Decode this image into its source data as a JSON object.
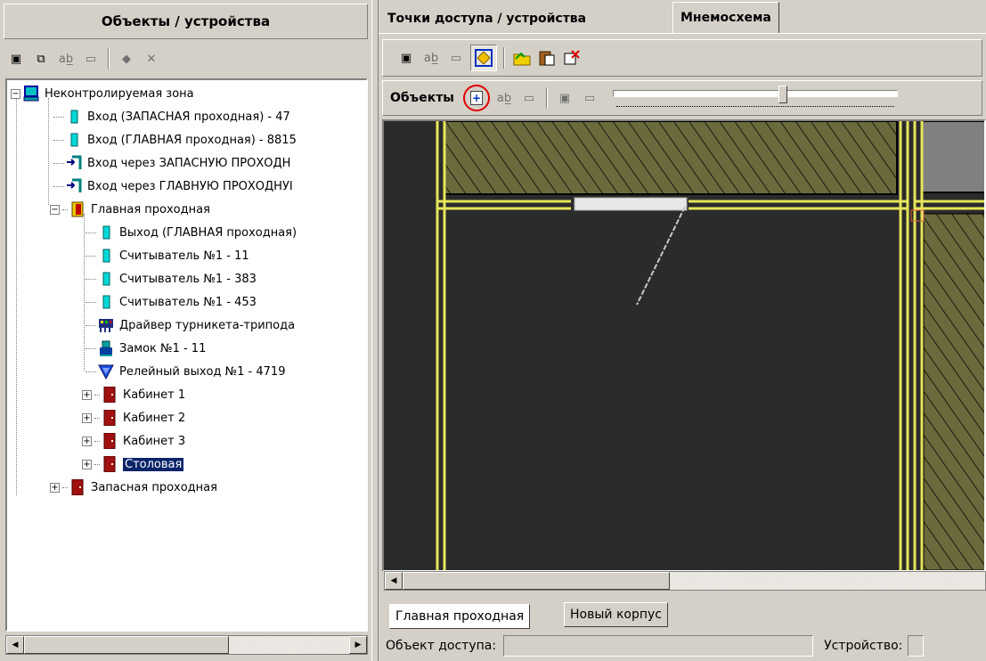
{
  "left_panel": {
    "title": "Объекты / устройства",
    "toolbar_icons": [
      "add-object-icon",
      "add-child-icon",
      "rename-icon",
      "delete-icon",
      "paint-icon",
      "remove-icon"
    ],
    "tree": [
      {
        "label": "Неконтролируемая зона",
        "icon": "computer-icon",
        "level": 0,
        "expander": "−"
      },
      {
        "label": "Вход (ЗАПАСНАЯ проходная) - 47",
        "icon": "reader-icon",
        "level": 1
      },
      {
        "label": "Вход (ГЛАВНАЯ проходная) - 8815",
        "icon": "reader-icon",
        "level": 1
      },
      {
        "label": "Вход через ЗАПАСНУЮ ПРОХОДН",
        "icon": "door-arrow-icon",
        "level": 1
      },
      {
        "label": "Вход через ГЛАВНУЮ ПРОХОДНУІ",
        "icon": "door-arrow-icon",
        "level": 1
      },
      {
        "label": "Главная проходная",
        "icon": "turnstile-door-icon",
        "level": 1,
        "expander": "−"
      },
      {
        "label": "Выход (ГЛАВНАЯ проходная)",
        "icon": "reader-icon",
        "level": 2
      },
      {
        "label": "Считыватель №1 - 11",
        "icon": "reader-icon",
        "level": 2
      },
      {
        "label": "Считыватель №1 - 383",
        "icon": "reader-icon",
        "level": 2
      },
      {
        "label": "Считыватель №1 - 453",
        "icon": "reader-icon",
        "level": 2
      },
      {
        "label": "Драйвер турникета-трипода",
        "icon": "driver-icon",
        "level": 2
      },
      {
        "label": "Замок №1 - 11",
        "icon": "lock-icon",
        "level": 2
      },
      {
        "label": "Релейный выход №1 - 4719",
        "icon": "relay-icon",
        "level": 2
      },
      {
        "label": "Кабинет 1",
        "icon": "door-icon",
        "level": 1,
        "expander": "+"
      },
      {
        "label": "Кабинет 2",
        "icon": "door-icon",
        "level": 1,
        "expander": "+"
      },
      {
        "label": "Кабинет 3",
        "icon": "door-icon",
        "level": 1,
        "expander": "+"
      },
      {
        "label": "Столовая",
        "icon": "door-icon",
        "level": 1,
        "expander": "+",
        "selected": true
      },
      {
        "label": "Запасная проходная",
        "icon": "door-icon",
        "level": 0,
        "expander": "+"
      }
    ]
  },
  "right_panel": {
    "tabs": [
      {
        "label": "Точки доступа / устройства",
        "active": false
      },
      {
        "label": "Мнемосхема",
        "active": true
      }
    ],
    "toolbar2_label": "Объекты",
    "zoom_slider_level": 0.6,
    "bottom_tabs": [
      {
        "label": "Главная проходная",
        "active": true
      },
      {
        "label": "Новый корпус",
        "active": false
      }
    ],
    "status": {
      "access_object_label": "Объект доступа:",
      "device_label": "Устройство:"
    }
  },
  "colors": {
    "window_bg": "#d4d0c8",
    "selection": "#0a246a",
    "canvas_bg": "#2b2b2b",
    "wall": "#e6e65a",
    "hatch": "#6b6a3d",
    "highlight_circle": "#e00000"
  }
}
